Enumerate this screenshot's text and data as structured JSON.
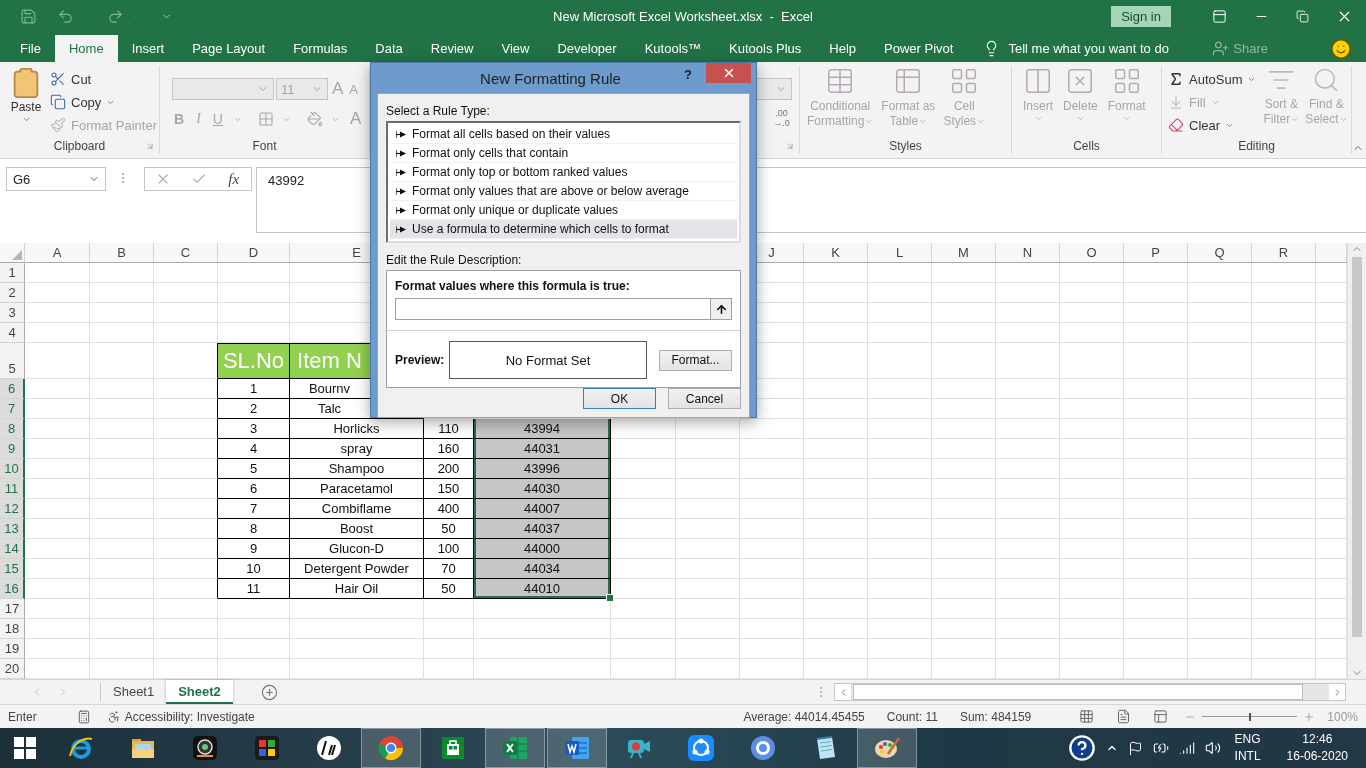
{
  "window": {
    "title": "New Microsoft Excel Worksheet.xlsx  -  Excel",
    "sign_in": "Sign in"
  },
  "menu_tabs": [
    {
      "label": "File",
      "selected": false
    },
    {
      "label": "Home",
      "selected": true
    },
    {
      "label": "Insert",
      "selected": false
    },
    {
      "label": "Page Layout",
      "selected": false
    },
    {
      "label": "Formulas",
      "selected": false
    },
    {
      "label": "Data",
      "selected": false
    },
    {
      "label": "Review",
      "selected": false
    },
    {
      "label": "View",
      "selected": false
    },
    {
      "label": "Developer",
      "selected": false
    },
    {
      "label": "Kutools™",
      "selected": false
    },
    {
      "label": "Kutools Plus",
      "selected": false
    },
    {
      "label": "Help",
      "selected": false
    },
    {
      "label": "Power Pivot",
      "selected": false
    }
  ],
  "tell_me": "Tell me what you want to do",
  "share": {
    "label": "Share",
    "disabled": true
  },
  "ribbon": {
    "clipboard": {
      "label": "Clipboard",
      "paste": "Paste",
      "items": [
        {
          "label": "Cut",
          "disabled": false
        },
        {
          "label": "Copy",
          "disabled": false
        },
        {
          "label": "Format Painter",
          "disabled": true
        }
      ]
    },
    "font": {
      "label": "Font",
      "disabled": true,
      "size": "11",
      "grow": "A",
      "shrink": "A",
      "bold": "B",
      "italic": "I",
      "underline": "U",
      "font_color": "A"
    },
    "number": {
      "decimal": [
        ".00",
        "→.0"
      ]
    },
    "styles": {
      "label": "Styles",
      "items": [
        {
          "lines": [
            "Conditional",
            "Formatting"
          ],
          "disabled": true
        },
        {
          "lines": [
            "Format as",
            "Table"
          ],
          "disabled": true
        },
        {
          "lines": [
            "Cell",
            "Styles"
          ],
          "disabled": true
        }
      ]
    },
    "cells": {
      "label": "Cells",
      "items": [
        {
          "label": "Insert",
          "disabled": true
        },
        {
          "label": "Delete",
          "disabled": true
        },
        {
          "label": "Format",
          "disabled": true
        }
      ]
    },
    "editing": {
      "label": "Editing",
      "small": [
        {
          "label": "AutoSum",
          "disabled": false
        },
        {
          "label": "Fill",
          "disabled": true
        },
        {
          "label": "Clear",
          "disabled": false
        }
      ],
      "large": [
        {
          "lines": [
            "Sort &",
            "Filter"
          ],
          "disabled": true
        },
        {
          "lines": [
            "Find &",
            "Select"
          ],
          "disabled": true
        }
      ]
    }
  },
  "formula_bar": {
    "name_box": "G6",
    "function_label": "fx",
    "value": "43992"
  },
  "sheet": {
    "column_headers_left": [
      "A",
      "B",
      "C",
      "D",
      "E"
    ],
    "column_headers_right": [
      "J",
      "K",
      "L",
      "M",
      "N",
      "O",
      "P",
      "Q",
      "R"
    ],
    "rows": [
      {
        "number": "1",
        "selected": false
      },
      {
        "number": "2",
        "selected": false
      },
      {
        "number": "3",
        "selected": false
      },
      {
        "number": "4",
        "selected": false
      },
      {
        "number": "5",
        "selected": false,
        "kind": "header",
        "cells": [
          "SL.No",
          "Item N"
        ]
      },
      {
        "number": "6",
        "selected": true,
        "kind": "data",
        "cells": [
          "1",
          "Bournv"
        ]
      },
      {
        "number": "7",
        "selected": true,
        "kind": "data",
        "cells": [
          "2",
          "Talc"
        ]
      },
      {
        "number": "8",
        "selected": true,
        "kind": "data",
        "cells": [
          "3",
          "Horlicks",
          "110",
          "43994"
        ]
      },
      {
        "number": "9",
        "selected": true,
        "kind": "data",
        "cells": [
          "4",
          "spray",
          "160",
          "44031"
        ]
      },
      {
        "number": "10",
        "selected": true,
        "kind": "data",
        "cells": [
          "5",
          "Shampoo",
          "200",
          "43996"
        ]
      },
      {
        "number": "11",
        "selected": true,
        "kind": "data",
        "cells": [
          "6",
          "Paracetamol",
          "150",
          "44030"
        ]
      },
      {
        "number": "12",
        "selected": true,
        "kind": "data",
        "cells": [
          "7",
          "Combiflame",
          "400",
          "44007"
        ]
      },
      {
        "number": "13",
        "selected": true,
        "kind": "data",
        "cells": [
          "8",
          "Boost",
          "50",
          "44037"
        ]
      },
      {
        "number": "14",
        "selected": true,
        "kind": "data",
        "cells": [
          "9",
          "Glucon-D",
          "100",
          "44000"
        ]
      },
      {
        "number": "15",
        "selected": true,
        "kind": "data",
        "cells": [
          "10",
          "Detergent Powder",
          "70",
          "44034"
        ]
      },
      {
        "number": "16",
        "selected": true,
        "kind": "data",
        "cells": [
          "11",
          "Hair Oil",
          "50",
          "44010"
        ]
      },
      {
        "number": "17",
        "selected": false
      },
      {
        "number": "18",
        "selected": false
      },
      {
        "number": "19",
        "selected": false
      },
      {
        "number": "20",
        "selected": false
      }
    ]
  },
  "dialog": {
    "title": "New Formatting Rule",
    "help": "?",
    "rule_type_label": "Select a Rule Type:",
    "rule_types": [
      {
        "label": "Format all cells based on their values",
        "selected": false
      },
      {
        "label": "Format only cells that contain",
        "selected": false
      },
      {
        "label": "Format only top or bottom ranked values",
        "selected": false
      },
      {
        "label": "Format only values that are above or below average",
        "selected": false
      },
      {
        "label": "Format only unique or duplicate values",
        "selected": false
      },
      {
        "label": "Use a formula to determine which cells to format",
        "selected": true
      }
    ],
    "description_label": "Edit the Rule Description:",
    "formula_label": "Format values where this formula is true:",
    "preview_label": "Preview:",
    "preview_text": "No Format Set",
    "format_button": "Format...",
    "buttons": [
      {
        "label": "OK",
        "default": true
      },
      {
        "label": "Cancel",
        "default": false
      }
    ]
  },
  "sheet_tabs": [
    {
      "label": "Sheet1",
      "selected": false
    },
    {
      "label": "Sheet2",
      "selected": true
    }
  ],
  "status_bar": {
    "mode": "Enter",
    "accessibility": "Accessibility: Investigate",
    "stats": [
      "Average: 44014.45455",
      "Count: 11",
      "Sum: 484159"
    ],
    "zoom": {
      "level": 0.5,
      "reading": "100%"
    }
  },
  "taskbar": {
    "apps": [
      {
        "running": false
      },
      {
        "running": false
      },
      {
        "running": false
      },
      {
        "running": false
      },
      {
        "running": false
      },
      {
        "running": true
      },
      {
        "running": false
      },
      {
        "running": true
      },
      {
        "running": true
      },
      {
        "running": false
      },
      {
        "running": false
      },
      {
        "running": false
      },
      {
        "running": false
      },
      {
        "running": true
      }
    ],
    "tray": {
      "language": "ENG",
      "layout": "INTL",
      "time": "12:46",
      "date": "16-06-2020"
    }
  }
}
